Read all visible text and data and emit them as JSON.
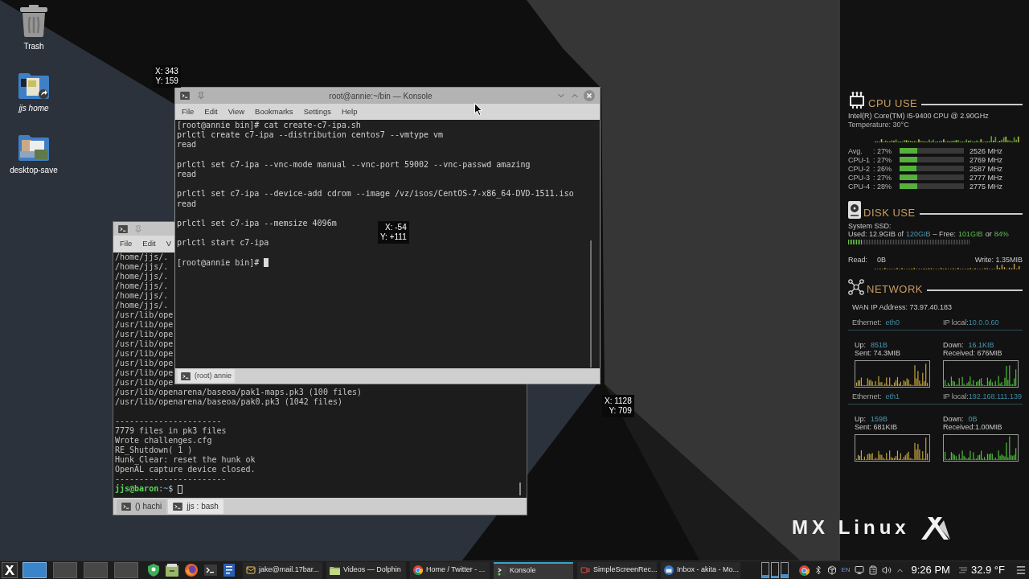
{
  "desktop_icons": [
    {
      "label": "Trash",
      "kind": "trash"
    },
    {
      "label": "jjs home",
      "kind": "home"
    },
    {
      "label": "desktop-save",
      "kind": "pictures"
    }
  ],
  "back_window": {
    "menu": [
      "File",
      "Edit",
      "V"
    ],
    "blocks": [
      [
        "/home/jjs/.",
        "/home/jjs/.",
        "/home/jjs/.",
        "/home/jjs/.",
        "/home/jjs/.",
        "/home/jjs/.",
        "/usr/lib/ope",
        "/usr/lib/ope",
        "/usr/lib/ope",
        "/usr/lib/ope",
        "/usr/lib/ope",
        "/usr/lib/ope",
        "/usr/lib/ope",
        "/usr/lib/ope",
        "/usr/lib/openarena/baseoa/pak1-maps.pk3 (100 files)",
        "/usr/lib/openarena/baseoa/pak0.pk3 (1042 files)"
      ],
      [
        "----------------------",
        "7779 files in pk3 files",
        "Wrote challenges.cfg",
        "RE_Shutdown( 1 )",
        "Hunk_Clear: reset the hunk ok",
        "OpenAL capture device closed.",
        "-----------------------"
      ]
    ],
    "prompt": {
      "blank_line_before": false,
      "cursor_filled": false,
      "parts": [
        {
          "text": "jjs@baron",
          "kind": "user"
        },
        {
          "text": ":",
          "kind": "plain"
        },
        {
          "text": "~",
          "kind": "path"
        },
        {
          "text": "$",
          "kind": "plain"
        }
      ]
    },
    "tabs": [
      {
        "label": "() hachi",
        "selected": false
      },
      {
        "label": "jjs : bash",
        "selected": true
      }
    ]
  },
  "front_window": {
    "title": "root@annie:~/bin — Konsole",
    "menu": [
      "File",
      "Edit",
      "View",
      "Bookmarks",
      "Settings",
      "Help"
    ],
    "blocks": [
      [
        "[root@annie bin]# cat create-c7-ipa.sh",
        "prlctl create c7-ipa --distribution centos7 --vmtype vm",
        "read"
      ],
      [
        "prlctl set c7-ipa --vnc-mode manual --vnc-port 59002 --vnc-passwd amazing",
        "read"
      ],
      [
        "prlctl set c7-ipa --device-add cdrom --image /vz/isos/CentOS-7-x86_64-DVD-1511.iso",
        "read"
      ],
      [
        "prlctl set c7-ipa --memsize 4096m"
      ],
      [
        "prlctl start c7-ipa"
      ]
    ],
    "prompt": {
      "blank_line_before": true,
      "cursor_filled": true,
      "parts": [
        {
          "text": "[root@annie bin]#",
          "kind": "plain"
        }
      ]
    },
    "tabs": [
      {
        "label": "(root) annie",
        "selected": true
      }
    ]
  },
  "pointer_readouts": [
    {
      "x": "X: 343",
      "y": "Y: 159"
    },
    {
      "x": "X: -54",
      "y": "Y: +111"
    },
    {
      "x": "X: 1128",
      "y": "Y: 709"
    }
  ],
  "conky": {
    "cpu": {
      "title": "CPU USE",
      "model": "Intel(R) Core(TM) I5-9400 CPU @ 2.90GHz",
      "temperature": "Temperature: 30°C",
      "cores": [
        {
          "name": "Avg.",
          "usage": ": 27%",
          "level": 0.27,
          "frequency": "2526 MHz"
        },
        {
          "name": "CPU-1",
          "usage": ": 27%",
          "level": 0.27,
          "frequency": "2769 MHz"
        },
        {
          "name": "CPU-2",
          "usage": ": 26%",
          "level": 0.26,
          "frequency": "2587 MHz"
        },
        {
          "name": "CPU-3",
          "usage": ": 27%",
          "level": 0.27,
          "frequency": "2777 MHz"
        },
        {
          "name": "CPU-4",
          "usage": ": 28%",
          "level": 0.28,
          "frequency": "2775 MHz"
        }
      ]
    },
    "disk": {
      "title": "DISK USE",
      "device": "System SSD:",
      "usage_parts": [
        {
          "text": "Used: 12.9GIB of",
          "kind": "plain"
        },
        {
          "text": "120GIB",
          "kind": "blue"
        },
        {
          "text": "– Free:",
          "kind": "plain"
        },
        {
          "text": "101GIB",
          "kind": "green"
        },
        {
          "text": "or",
          "kind": "plain"
        },
        {
          "text": "84%",
          "kind": "green"
        }
      ],
      "level": 0.11,
      "read_label": "Read:",
      "read_value": "0B",
      "write": "Write: 1.35MIB"
    },
    "network": {
      "title": "NETWORK",
      "wan": "WAN IP Address: 73.97.40.183",
      "interfaces": [
        {
          "label": "Ethernet:",
          "name": "eth0",
          "ip_label": "IP local:",
          "ip": "10.0.0.60",
          "up_label": "Up:",
          "up": "851B",
          "sent": "Sent: 74.3MIB",
          "down_label": "Down:",
          "down": "16.1KIB",
          "received": "Received: 676MIB"
        },
        {
          "label": "Ethernet:",
          "name": "eth1",
          "ip_label": "IP local:",
          "ip": "192.168.111.139",
          "up_label": "Up:",
          "up": "159B",
          "sent": "Sent: 681KIB",
          "down_label": "Down:",
          "down": "0B",
          "received": "Received:1.00MIB"
        }
      ]
    }
  },
  "logo": {
    "text": "MX Linux"
  },
  "taskbar": {
    "pager": [
      {
        "selected": true
      },
      {
        "selected": false
      },
      {
        "selected": false
      },
      {
        "selected": false
      }
    ],
    "tasks": [
      {
        "label": "jake@mail.17bar...",
        "kind": "mail",
        "selected": false
      },
      {
        "label": "Videos — Dolphin",
        "kind": "files",
        "selected": false
      },
      {
        "label": "Home / Twitter - ...",
        "kind": "browser",
        "selected": false
      },
      {
        "label": "Konsole",
        "kind": "terminal",
        "selected": true
      },
      {
        "label": "SimpleScreenRec...",
        "kind": "recorder",
        "selected": false
      },
      {
        "label": "Inbox - akita - Mo...",
        "kind": "mail-client",
        "selected": false
      }
    ],
    "keyboard_layout": "EN",
    "clock": "9:26 PM",
    "weather": "32.9 °F"
  }
}
